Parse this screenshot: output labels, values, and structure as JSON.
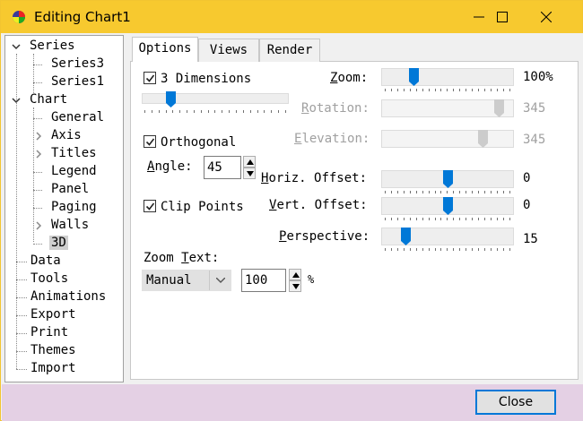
{
  "window": {
    "title": "Editing Chart1"
  },
  "tree": {
    "series": "Series",
    "series3": "Series3",
    "series1": "Series1",
    "chart": "Chart",
    "general": "General",
    "axis": "Axis",
    "titles": "Titles",
    "legend": "Legend",
    "panel": "Panel",
    "paging": "Paging",
    "walls": "Walls",
    "d3": "3D",
    "data": "Data",
    "tools": "Tools",
    "animations": "Animations",
    "export": "Export",
    "print": "Print",
    "themes": "Themes",
    "import": "Import"
  },
  "tabs": {
    "options": "Options",
    "views": "Views",
    "render": "Render"
  },
  "options": {
    "three_d": {
      "label": "3 Dimensions",
      "checked": true,
      "level": 0.17
    },
    "orthogonal": {
      "label": "Orthogonal",
      "checked": true
    },
    "angle": {
      "label": "Angle:",
      "value": "45"
    },
    "clip_points": {
      "label": "Clip Points",
      "checked": true
    },
    "zoom_text": {
      "label": "Zoom Text:",
      "mode": "Manual",
      "value": "100",
      "unit": "%"
    }
  },
  "sliders": {
    "zoom": {
      "label": "Zoom:",
      "value": "100%",
      "level": 0.22
    },
    "rotation": {
      "label": "Rotation:",
      "value": "345",
      "level": 0.93,
      "disabled": true
    },
    "elevation": {
      "label": "Elevation:",
      "value": "345",
      "level": 0.8,
      "disabled": true
    },
    "horiz_offset": {
      "label": "Horiz. Offset:",
      "value": "0",
      "level": 0.5
    },
    "vert_offset": {
      "label": "Vert. Offset:",
      "value": "0",
      "level": 0.5
    },
    "perspective": {
      "label": "Perspective:",
      "value": "15",
      "level": 0.15
    }
  },
  "buttons": {
    "close": "Close"
  },
  "colors": {
    "titlebar": "#f7c92f",
    "accent": "#0078d7",
    "footer": "#e4d0e4"
  }
}
